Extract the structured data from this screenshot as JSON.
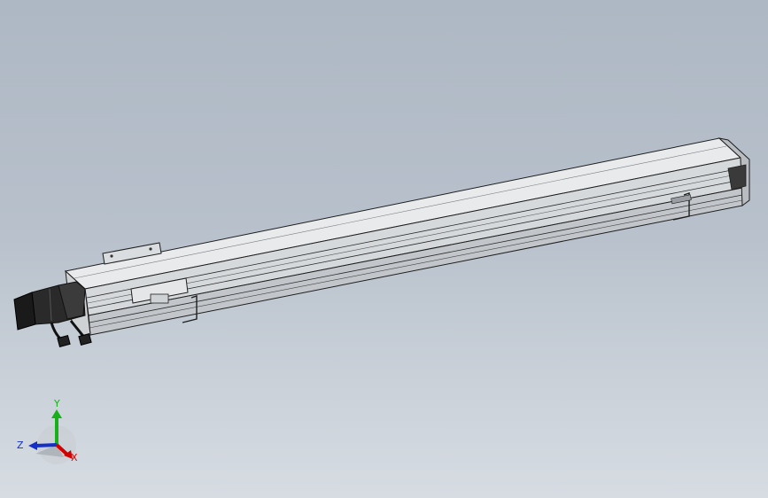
{
  "view": {
    "background_top": "#aeb8c4",
    "background_bottom": "#d6dce2"
  },
  "model": {
    "description_icon": "linear-actuator-module",
    "body_color": "#d9dcdf",
    "edge_color": "#1e1e1e",
    "motor_color": "#2a2a2a"
  },
  "triad": {
    "x_label": "X",
    "y_label": "Y",
    "z_label": "Z",
    "x_color": "#d40000",
    "y_color": "#18b018",
    "z_color": "#1530c8"
  }
}
